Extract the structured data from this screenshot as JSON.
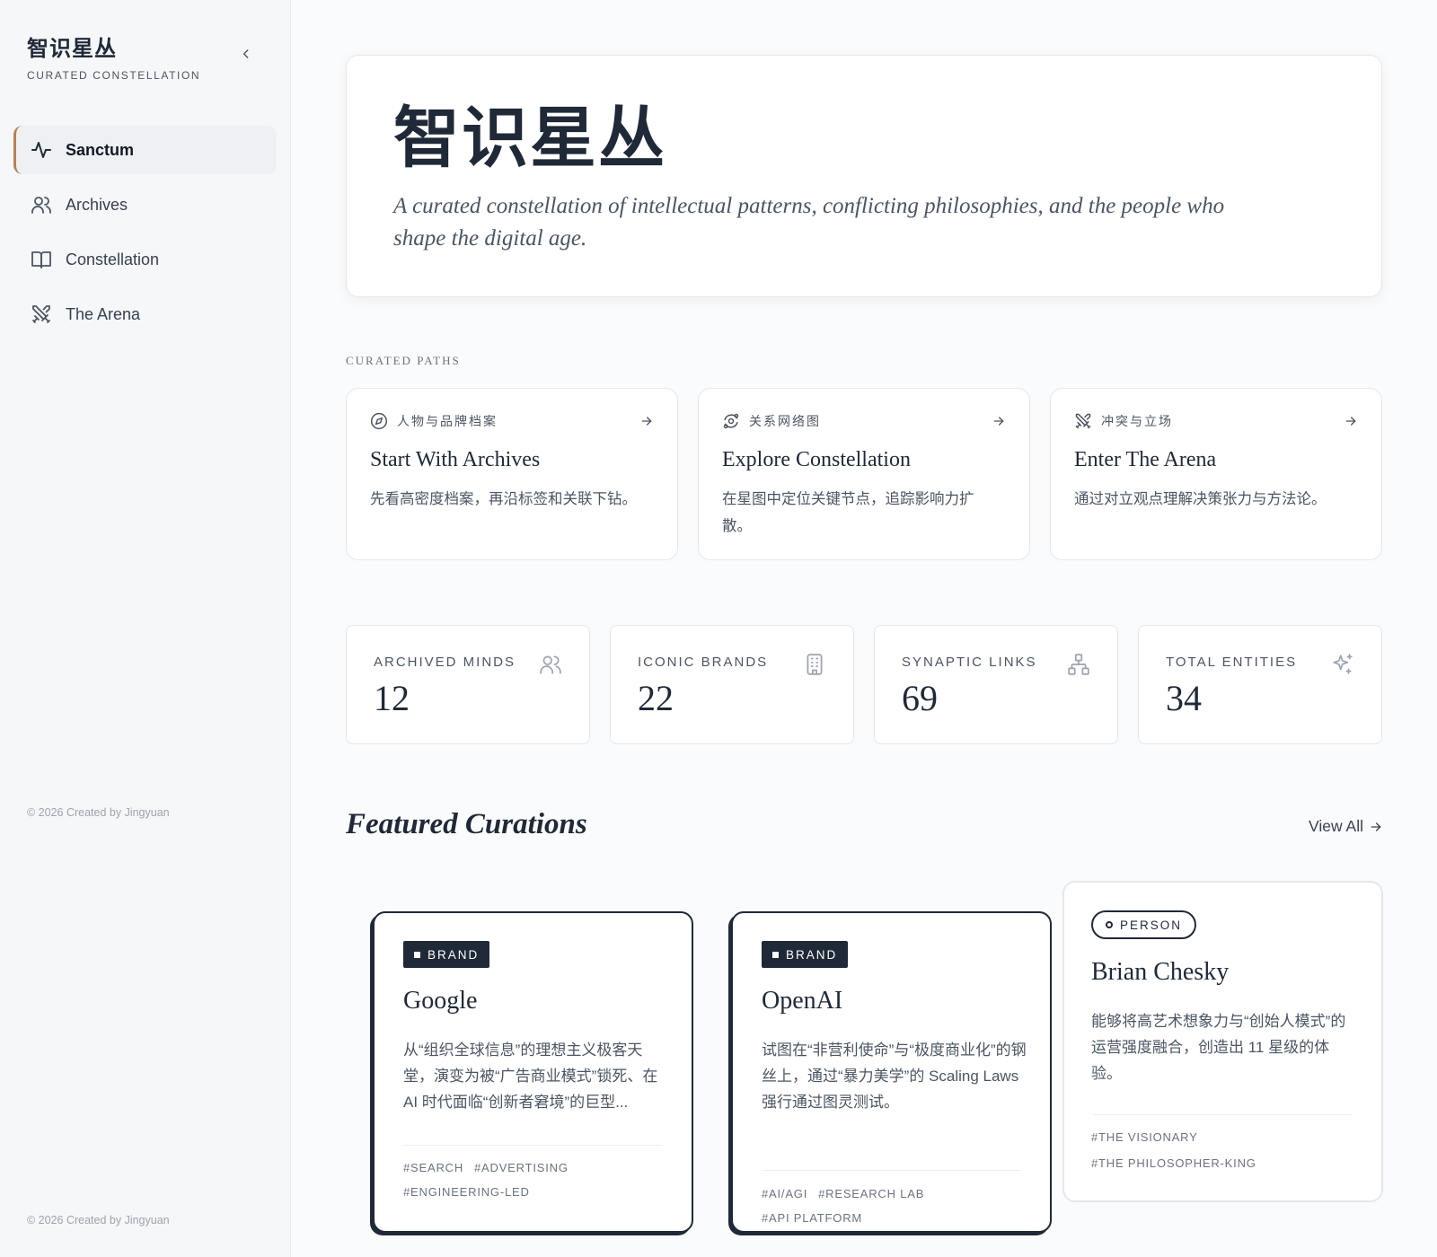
{
  "sidebar": {
    "brand_title": "智识星丛",
    "brand_subtitle": "CURATED CONSTELLATION",
    "collapse_icon": "chevron-left-icon",
    "items": [
      {
        "label": "Sanctum",
        "icon": "pulse-icon",
        "active": true
      },
      {
        "label": "Archives",
        "icon": "users-icon",
        "active": false
      },
      {
        "label": "Constellation",
        "icon": "book-open-icon",
        "active": false
      },
      {
        "label": "The Arena",
        "icon": "crossed-swords-icon",
        "active": false
      }
    ],
    "footer_note": "© 2026 Created by Jingyuan",
    "footer_note_bottom": "© 2026 Created by Jingyuan"
  },
  "hero": {
    "title": "智识星丛",
    "description": "A curated constellation of intellectual patterns, conflicting philosophies, and the people who shape the digital age."
  },
  "curated_paths": {
    "label": "CURATED PATHS",
    "items": [
      {
        "kicker": "人物与品牌档案",
        "icon": "compass-icon",
        "title": "Start With Archives",
        "desc": "先看高密度档案，再沿标签和关联下钻。"
      },
      {
        "kicker": "关系网络图",
        "icon": "orbit-icon",
        "title": "Explore Constellation",
        "desc": "在星图中定位关键节点，追踪影响力扩散。"
      },
      {
        "kicker": "冲突与立场",
        "icon": "crossed-swords-icon",
        "title": "Enter The Arena",
        "desc": "通过对立观点理解决策张力与方法论。"
      }
    ]
  },
  "stats": [
    {
      "label": "ARCHIVED MINDS",
      "value": "12",
      "icon": "users-icon"
    },
    {
      "label": "ICONIC BRANDS",
      "value": "22",
      "icon": "building-icon"
    },
    {
      "label": "SYNAPTIC LINKS",
      "value": "69",
      "icon": "network-icon"
    },
    {
      "label": "TOTAL ENTITIES",
      "value": "34",
      "icon": "sparkles-icon"
    }
  ],
  "featured": {
    "title": "Featured Curations",
    "view_all": "View All",
    "cards": [
      {
        "type": "BRAND",
        "title": "Google",
        "desc": "从“组织全球信息”的理想主义极客天堂，演变为被“广告商业模式”锁死、在 AI 时代面临“创新者窘境”的巨型...",
        "tags": [
          "#SEARCH",
          "#ADVERTISING",
          "#ENGINEERING-LED"
        ]
      },
      {
        "type": "BRAND",
        "title": "OpenAI",
        "desc": "试图在“非营利使命”与“极度商业化”的钢丝上，通过“暴力美学”的 Scaling Laws 强行通过图灵测试。",
        "tags": [
          "#AI/AGI",
          "#RESEARCH LAB",
          "#API PLATFORM"
        ]
      },
      {
        "type": "PERSON",
        "title": "Brian Chesky",
        "desc": "能够将高艺术想象力与“创始人模式”的运营强度融合，创造出 11 星级的体验。",
        "tags": [
          "#THE VISIONARY",
          "#THE PHILOSOPHER-KING"
        ]
      }
    ]
  },
  "colors": {
    "accent": "#b98255",
    "ink": "#1f2937",
    "muted": "#6b7280",
    "background": "#fafbfc"
  }
}
